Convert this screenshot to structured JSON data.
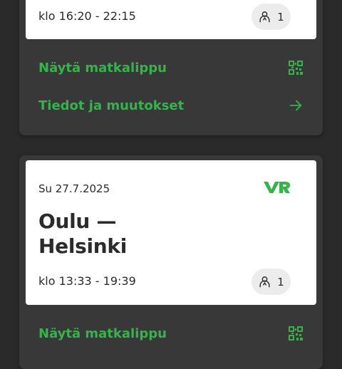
{
  "trips": [
    {
      "time": "klo 16:20 - 22:15",
      "passengers": "1",
      "show_ticket": "Näytä matkalippu",
      "details": "Tiedot ja muutokset"
    },
    {
      "date": "Su 27.7.2025",
      "route_from": "Oulu —",
      "route_to": "Helsinki",
      "time": "klo 13:33 - 19:39",
      "passengers": "1",
      "show_ticket": "Näytä matkalippu"
    }
  ],
  "icons": {
    "qr": "qr-code-icon",
    "arrow": "arrow-right-icon",
    "passenger": "person-icon",
    "logo": "vr-logo"
  },
  "colors": {
    "accent": "#34b44a",
    "card": "#ffffff",
    "panel": "#383838",
    "background": "#2a2a2a"
  }
}
